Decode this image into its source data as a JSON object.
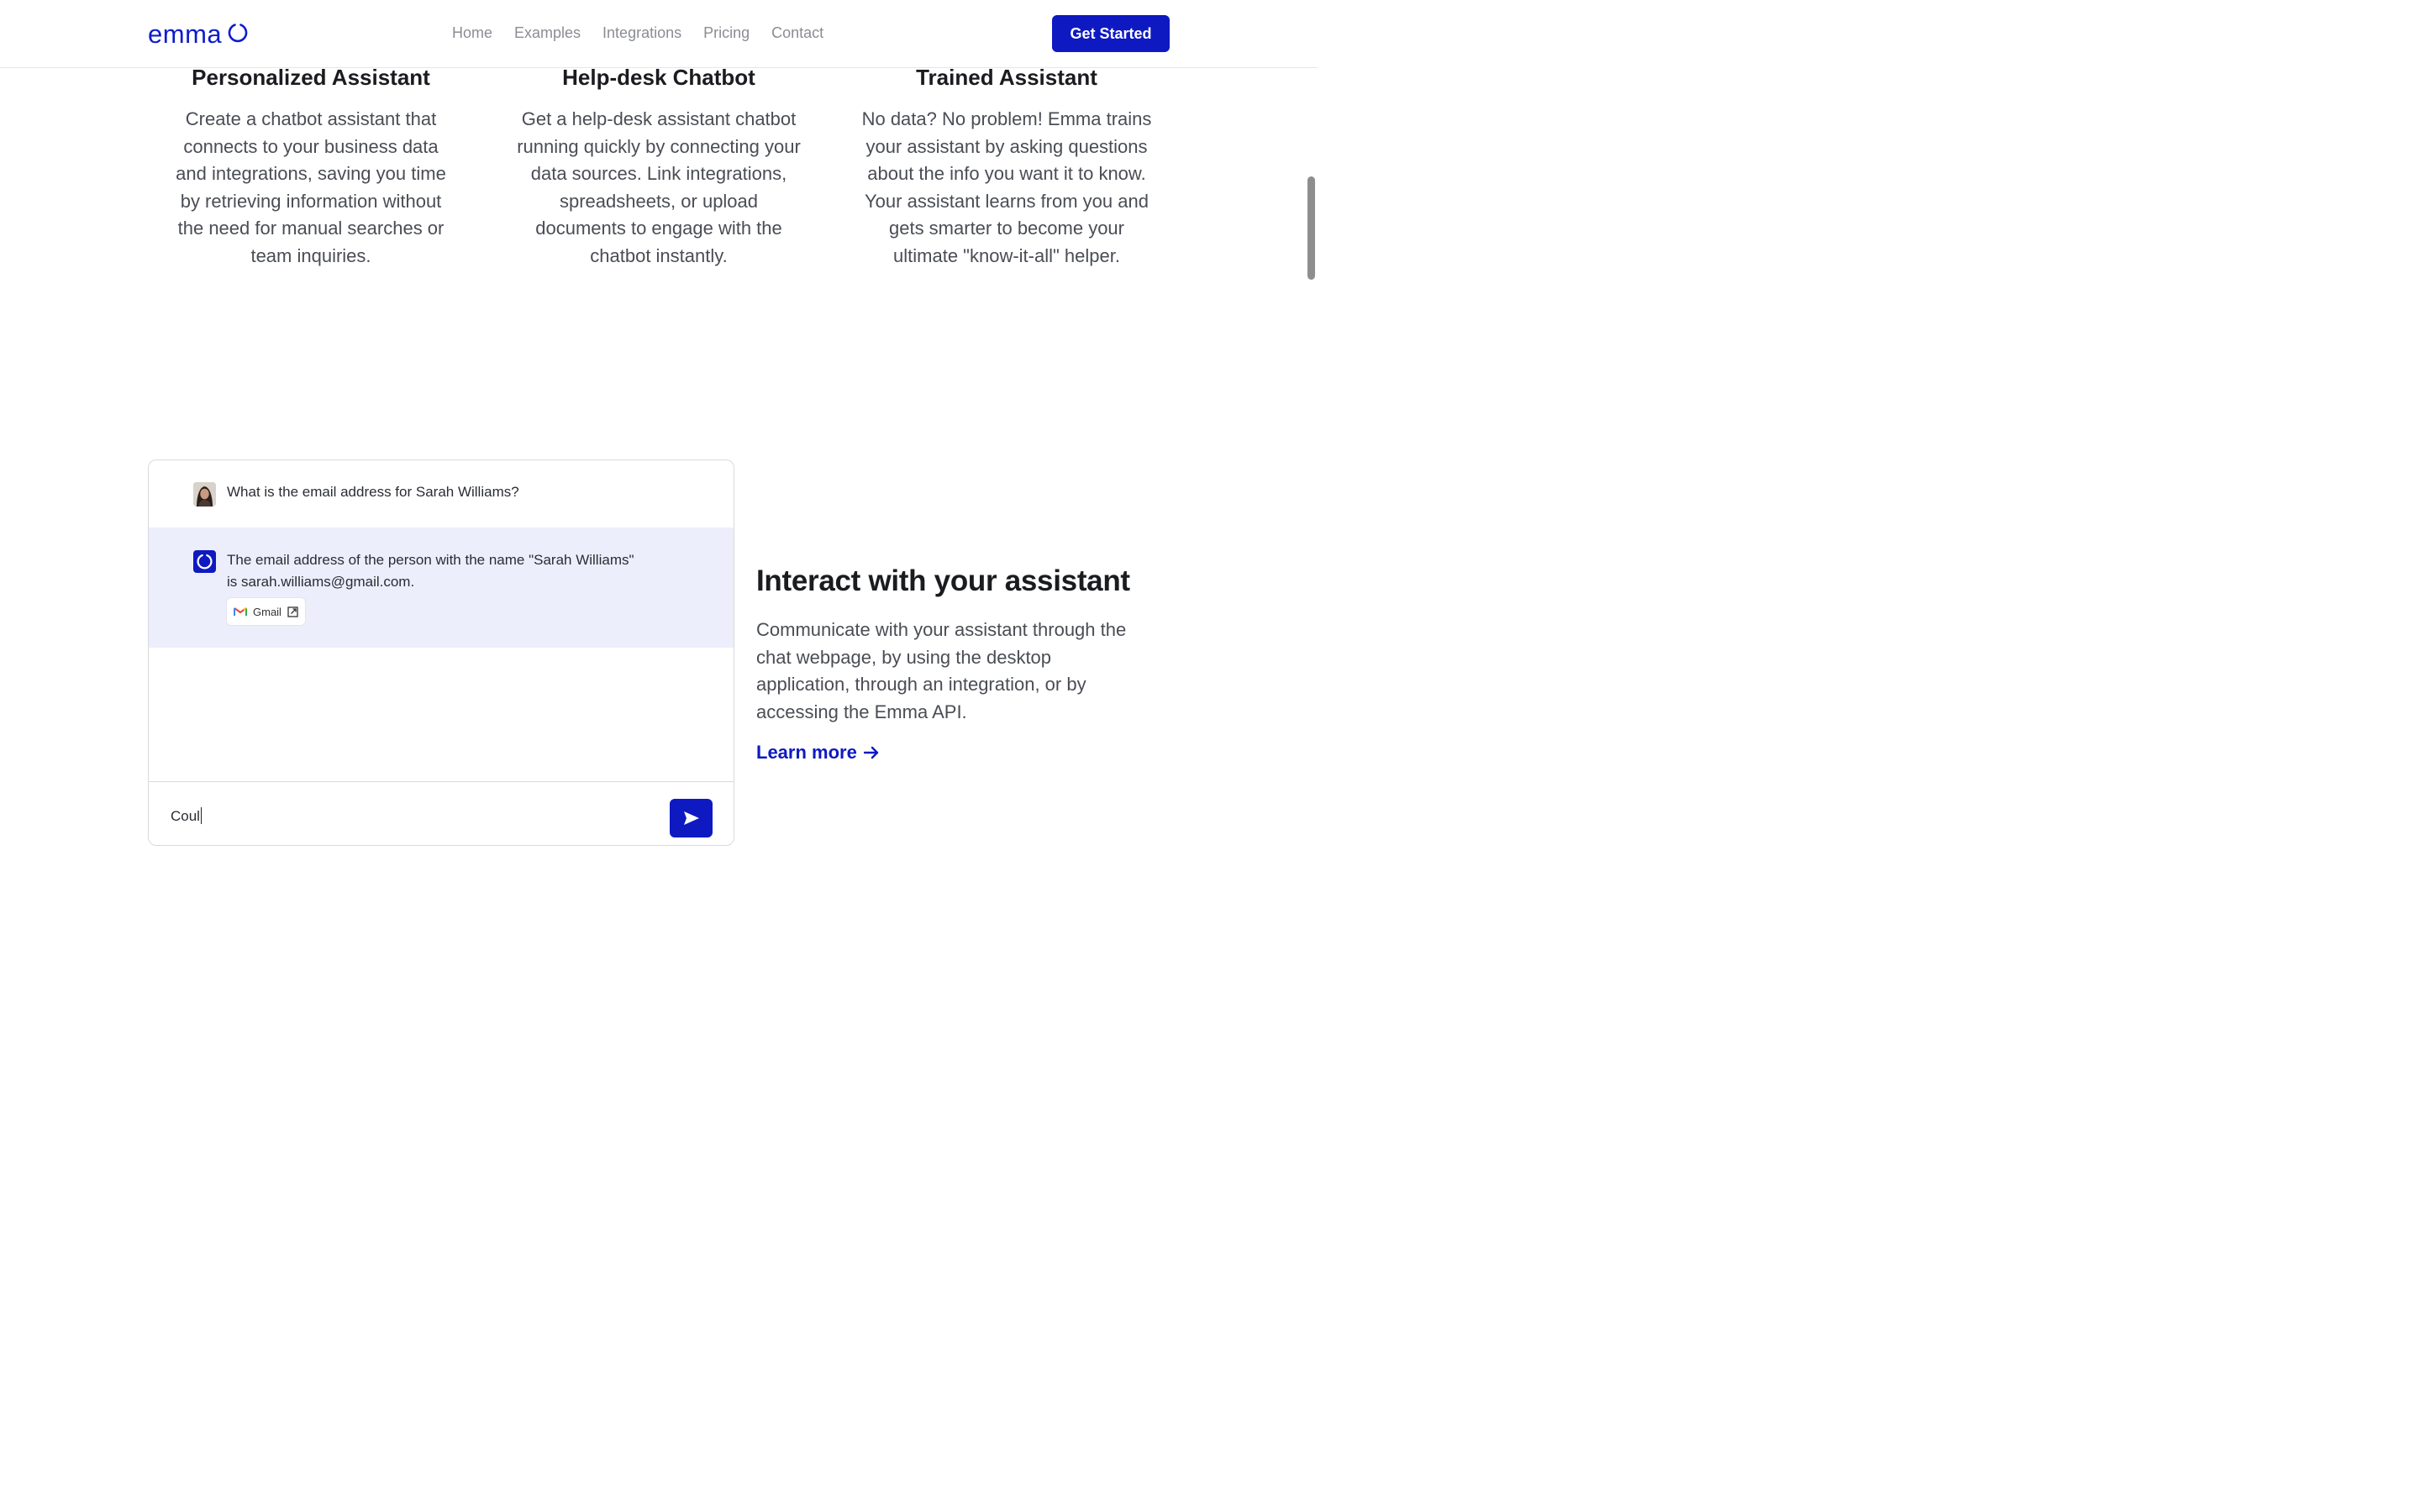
{
  "header": {
    "logo_text": "emma",
    "nav": [
      "Home",
      "Examples",
      "Integrations",
      "Pricing",
      "Contact"
    ],
    "cta_label": "Get Started",
    "brand_color": "#0e19c2"
  },
  "features": [
    {
      "title": "Personalized Assistant",
      "lines": [
        "Create a chatbot assistant that",
        "connects to your business data",
        "and integrations, saving you time",
        "by retrieving information without",
        "the need for manual searches or",
        "team inquiries."
      ]
    },
    {
      "title": "Help-desk Chatbot",
      "lines": [
        "Get a help-desk assistant chatbot",
        "running quickly by connecting your",
        "data sources. Link integrations,",
        "spreadsheets, or upload",
        "documents to engage with the",
        "chatbot instantly."
      ]
    },
    {
      "title": "Trained Assistant",
      "lines": [
        "No data? No problem! Emma trains",
        "your assistant by asking questions",
        "about the info you want it to know.",
        "Your assistant learns from you and",
        "gets smarter to become your",
        "ultimate \"know-it-all\" helper."
      ]
    }
  ],
  "chat": {
    "user_message": "What is the email address for Sarah Williams?",
    "bot_message_line1": "The email address of the person with the name \"Sarah Williams\"",
    "bot_message_line2": "is sarah.williams@gmail.com.",
    "source_label": "Gmail",
    "input_value": "Coul",
    "icons": {
      "user": "avatar",
      "bot": "emma-ring-icon",
      "source": "gmail-icon",
      "external": "external-link-icon",
      "send": "send-icon"
    }
  },
  "interact": {
    "title": "Interact with your assistant",
    "lines": [
      "Communicate with your assistant through the",
      "chat webpage, by using the desktop",
      "application, through an integration, or by",
      "accessing the Emma API."
    ],
    "link_label": "Learn more"
  }
}
